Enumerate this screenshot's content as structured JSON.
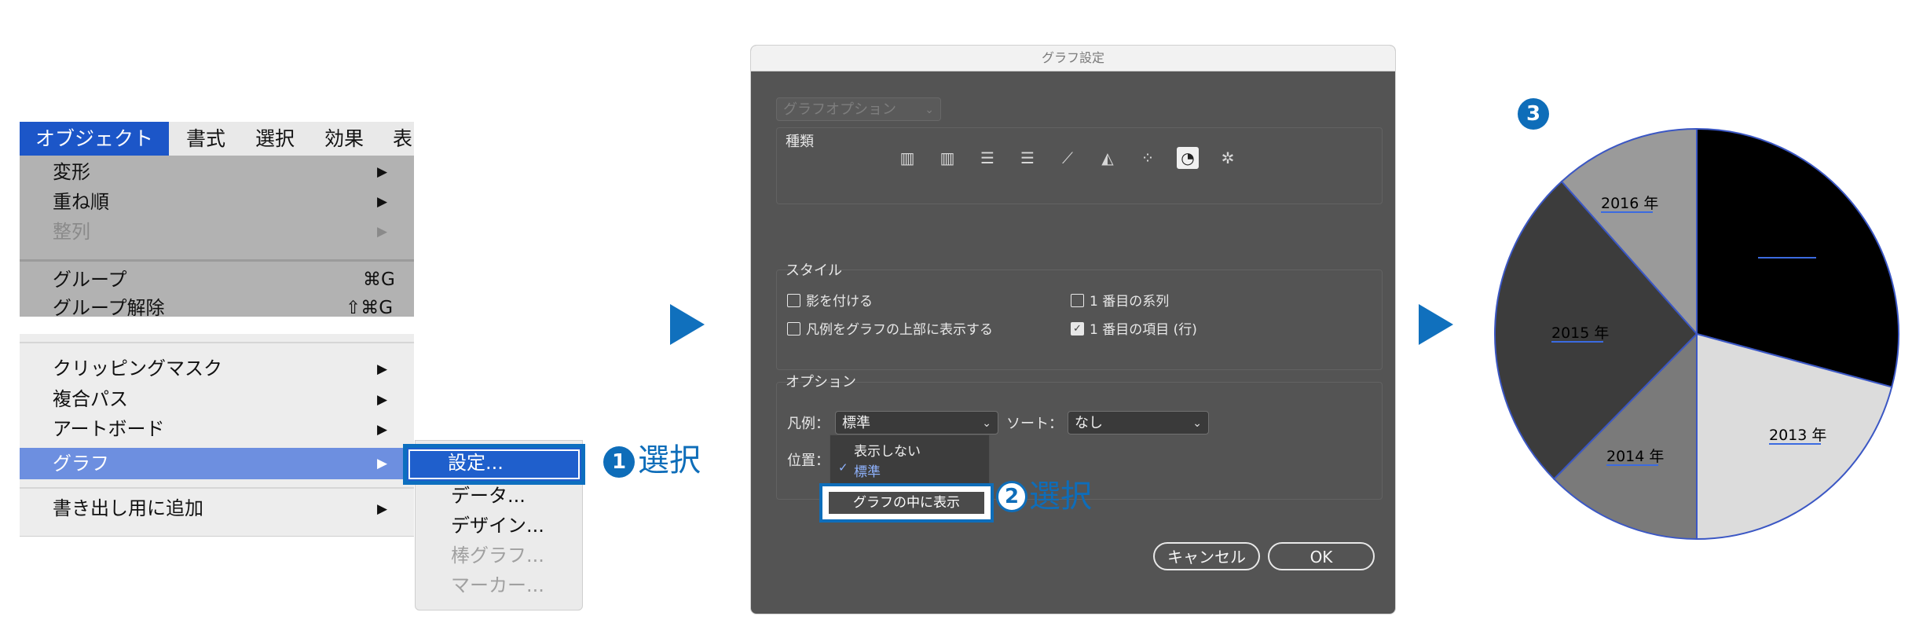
{
  "menu": {
    "bar": [
      "オブジェクト",
      "書式",
      "選択",
      "効果",
      "表"
    ],
    "items_top": [
      {
        "label": "変形",
        "arrow": "▶"
      },
      {
        "label": "重ね順",
        "arrow": "▶"
      },
      {
        "label": "整列",
        "arrow": "▶"
      },
      {
        "label": "グループ",
        "shortcut": "⌘G"
      },
      {
        "label": "グループ解除",
        "shortcut": "⇧⌘G"
      }
    ],
    "items_bottom": [
      {
        "label": "クリッピングマスク",
        "arrow": "▶"
      },
      {
        "label": "複合パス",
        "arrow": "▶"
      },
      {
        "label": "アートボード",
        "arrow": "▶"
      },
      {
        "label": "グラフ",
        "arrow": "▶"
      },
      {
        "label": "書き出し用に追加",
        "arrow": "▶"
      }
    ],
    "submenu": [
      "設定...",
      "データ...",
      "デザイン...",
      "棒グラフ...",
      "マーカー..."
    ]
  },
  "steps": [
    {
      "num": "1",
      "label": "選択"
    },
    {
      "num": "2",
      "label": "選択"
    },
    {
      "num": "3"
    }
  ],
  "dialog": {
    "title": "グラフ設定",
    "options_select": "グラフオプション",
    "type_label": "種類",
    "type_icons": [
      "column-graph-icon",
      "stacked-column-graph-icon",
      "bar-graph-icon",
      "stacked-bar-graph-icon",
      "line-graph-icon",
      "area-graph-icon",
      "scatter-graph-icon",
      "pie-graph-icon",
      "radar-graph-icon"
    ],
    "style_label": "スタイル",
    "checkboxes": [
      {
        "label": "影を付ける",
        "checked": false
      },
      {
        "label": "凡例をグラフの上部に表示する",
        "checked": false
      },
      {
        "label": "1 番目の系列",
        "checked": false
      },
      {
        "label": "1 番目の項目 (行)",
        "checked": true
      }
    ],
    "option_label": "オプション",
    "legend_label": "凡例：",
    "legend_value": "標準",
    "sort_label": "ソート：",
    "sort_value": "なし",
    "position_label": "位置：",
    "dropdown_items": [
      "表示しない",
      "標準",
      "グラフの中に表示"
    ],
    "cancel_label": "キャンセル",
    "ok_label": "OK"
  },
  "chart_data": {
    "type": "pie",
    "categories": [
      "2013 年",
      "2014 年",
      "2015 年",
      "2016 年"
    ],
    "colors": [
      "#000000",
      "#dcdcdc",
      "#7a7a7a",
      "#3c3c3c",
      "#9a9a9a"
    ],
    "labels_visible": [
      "2013 年",
      "2014 年",
      "2015 年",
      "2016 年"
    ]
  }
}
